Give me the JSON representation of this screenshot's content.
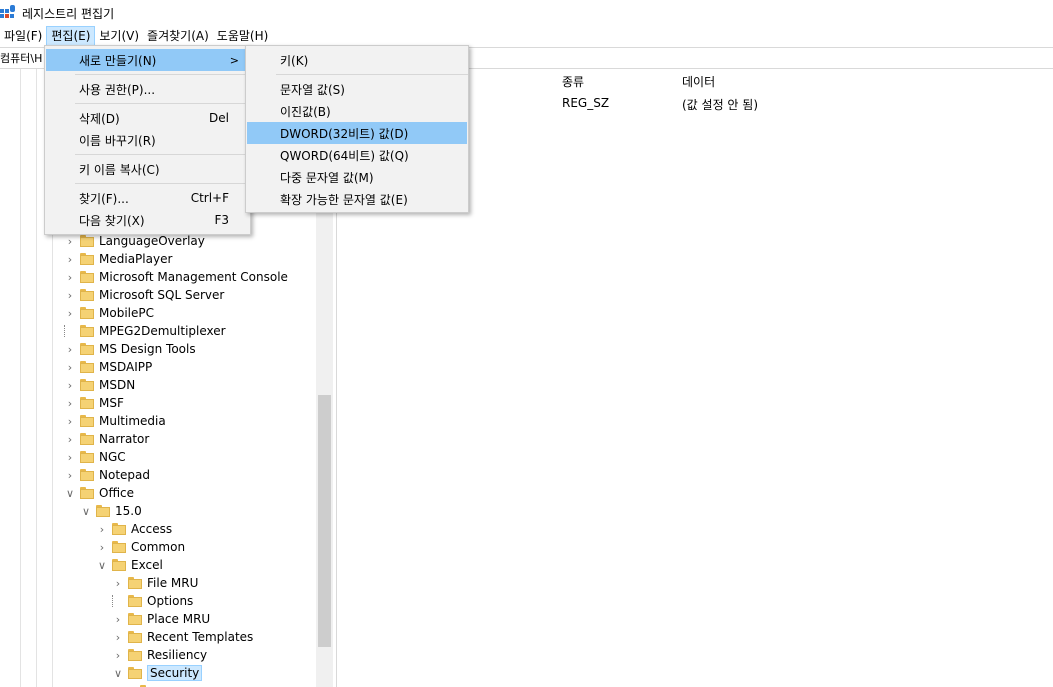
{
  "window": {
    "title": "레지스트리 편집기",
    "icon": "regedit-icon"
  },
  "menubar": {
    "items": [
      {
        "label": "파일(F)"
      },
      {
        "label": "편집(E)"
      },
      {
        "label": "보기(V)"
      },
      {
        "label": "즐겨찾기(A)"
      },
      {
        "label": "도움말(H)"
      }
    ]
  },
  "address": {
    "value": "컴퓨터\\H"
  },
  "list": {
    "columns": {
      "type": "종류",
      "data": "데이터"
    },
    "rows": [
      {
        "type": "REG_SZ",
        "data": "(값 설정 안 됨)"
      }
    ]
  },
  "edit_menu": {
    "items": [
      {
        "label": "새로 만들기(N)",
        "arrow": ">"
      },
      {
        "label": "사용 권한(P)..."
      },
      {
        "label": "삭제(D)",
        "shortcut": "Del"
      },
      {
        "label": "이름 바꾸기(R)"
      },
      {
        "label": "키 이름 복사(C)"
      },
      {
        "label": "찾기(F)...",
        "shortcut": "Ctrl+F"
      },
      {
        "label": "다음 찾기(X)",
        "shortcut": "F3"
      }
    ]
  },
  "new_submenu": {
    "items": [
      {
        "label": "키(K)"
      },
      {
        "label": "문자열 값(S)"
      },
      {
        "label": "이진값(B)"
      },
      {
        "label": "DWORD(32비트) 값(D)"
      },
      {
        "label": "QWORD(64비트) 값(Q)"
      },
      {
        "label": "다중 문자열 값(M)"
      },
      {
        "label": "확장 가능한 문자열 값(E)"
      }
    ]
  },
  "tree": {
    "items": [
      {
        "label": "LanguageOverlay",
        "expander": ">"
      },
      {
        "label": "MediaPlayer",
        "expander": ">"
      },
      {
        "label": "Microsoft Management Console",
        "expander": ">"
      },
      {
        "label": "Microsoft SQL Server",
        "expander": ">"
      },
      {
        "label": "MobilePC",
        "expander": ">"
      },
      {
        "label": "MPEG2Demultiplexer",
        "expander": ""
      },
      {
        "label": "MS Design Tools",
        "expander": ">"
      },
      {
        "label": "MSDAIPP",
        "expander": ">"
      },
      {
        "label": "MSDN",
        "expander": ">"
      },
      {
        "label": "MSF",
        "expander": ">"
      },
      {
        "label": "Multimedia",
        "expander": ">"
      },
      {
        "label": "Narrator",
        "expander": ">"
      },
      {
        "label": "NGC",
        "expander": ">"
      },
      {
        "label": "Notepad",
        "expander": ">"
      },
      {
        "label": "Office",
        "expander": "v"
      },
      {
        "label": "15.0",
        "expander": "v"
      },
      {
        "label": "Access",
        "expander": ">"
      },
      {
        "label": "Common",
        "expander": ">"
      },
      {
        "label": "Excel",
        "expander": "v"
      },
      {
        "label": "File MRU",
        "expander": ">"
      },
      {
        "label": "Options",
        "expander": ""
      },
      {
        "label": "Place MRU",
        "expander": ">"
      },
      {
        "label": "Recent Templates",
        "expander": ">"
      },
      {
        "label": "Resiliency",
        "expander": ">"
      },
      {
        "label": "Security",
        "expander": "v"
      }
    ]
  },
  "colors": {
    "highlight": "#91c9f7",
    "selection": "#cce8ff",
    "folder": "#f5d274"
  }
}
